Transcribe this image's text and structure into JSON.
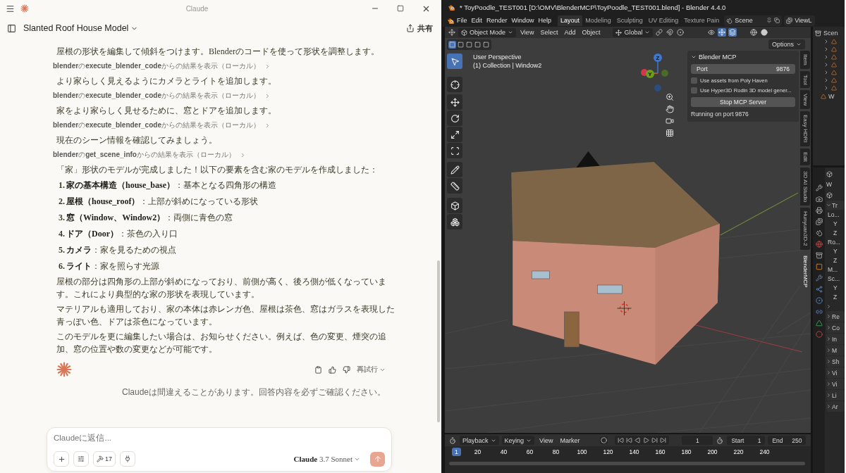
{
  "claude": {
    "window_title": "Claude",
    "conversation_title": "Slanted Roof House Model",
    "share_label": "共有",
    "messages": [
      {
        "kind": "text",
        "text": "屋根の形状を編集して傾斜をつけます。Blenderのコードを使って形状を調整します。"
      },
      {
        "kind": "tool",
        "text": "**blender**の**execute_blender_code**からの結果を表示（ローカル）"
      },
      {
        "kind": "text",
        "text": "より家らしく見えるようにカメラとライトを追加します。"
      },
      {
        "kind": "tool",
        "text": "**blender**の**execute_blender_code**からの結果を表示（ローカル）"
      },
      {
        "kind": "text",
        "text": "家をより家らしく見せるために、窓とドアを追加します。"
      },
      {
        "kind": "tool",
        "text": "**blender**の**execute_blender_code**からの結果を表示（ローカル）"
      },
      {
        "kind": "text",
        "text": "現在のシーン情報を確認してみましょう。"
      },
      {
        "kind": "tool",
        "text": "**blender**の**get_scene_info**からの結果を表示（ローカル）"
      },
      {
        "kind": "para",
        "text": "「家」形状のモデルが完成しました！以下の要素を含む家のモデルを作成しました："
      },
      {
        "kind": "item",
        "number": "1.",
        "text": "**家の基本構造（house_base）**：基本となる四角形の構造"
      },
      {
        "kind": "item",
        "number": "2.",
        "text": "**屋根（house_roof）**：上部が斜めになっている形状"
      },
      {
        "kind": "item",
        "number": "3.",
        "text": "**窓（Window、Window2）**：両側に青色の窓"
      },
      {
        "kind": "item",
        "number": "4.",
        "text": "**ドア（Door）**：茶色の入り口"
      },
      {
        "kind": "item",
        "number": "5.",
        "text": "**カメラ**：家を見るための視点"
      },
      {
        "kind": "item",
        "number": "6.",
        "text": "**ライト**：家を照らす光源"
      },
      {
        "kind": "para",
        "text": "屋根の部分は四角形の上部が斜めになっており、前側が高く、後ろ側が低くなっています。これにより典型的な家の形状を表現しています。"
      },
      {
        "kind": "para",
        "text": "マテリアルも適用しており、家の本体は赤レンガ色、屋根は茶色、窓はガラスを表現した青っぽい色、ドアは茶色になっています。"
      },
      {
        "kind": "para",
        "text": "このモデルを更に編集したい場合は、お知らせください。例えば、色の変更、煙突の追加、窓の位置や数の変更などが可能です。"
      }
    ],
    "retry_label": "再試行",
    "disclaimer": "Claudeは間違えることがあります。回答内容を必ずご確認ください。",
    "composer": {
      "placeholder": "Claudeに返信...",
      "tools_count": "17",
      "model": "**Claude** 3.7 Sonnet"
    }
  },
  "blender": {
    "window_title": "* ToyPoodle_TEST001 [D:\\OMV\\BlenderMCP\\ToyPoodle_TEST001.blend] - Blender 4.4.0",
    "menu": [
      "File",
      "Edit",
      "Render",
      "Window",
      "Help"
    ],
    "workspaces": [
      {
        "label": "Layout",
        "selected": true
      },
      {
        "label": "Modeling",
        "selected": false
      },
      {
        "label": "Sculpting",
        "selected": false
      },
      {
        "label": "UV Editing",
        "selected": false
      },
      {
        "label": "Texture Pain",
        "selected": false
      }
    ],
    "scene": "Scene",
    "view_layer": "ViewL",
    "header": {
      "mode": "Object Mode",
      "menus": [
        "View",
        "Select",
        "Add",
        "Object"
      ],
      "orientation": "Global",
      "options_label": "Options"
    },
    "viewport": {
      "view_name": "User Perspective",
      "collection": "(1) Collection | Window2",
      "gizmo_labels": [
        "Z",
        "Y"
      ],
      "tools": [
        {
          "kind": "select",
          "selected": true
        },
        {
          "kind": "cursor",
          "selected": false
        },
        {
          "kind": "move",
          "selected": false
        },
        {
          "kind": "rotate",
          "selected": false
        },
        {
          "kind": "scale",
          "selected": false
        },
        {
          "kind": "transform",
          "selected": false
        },
        {
          "kind": "annotate",
          "selected": false
        },
        {
          "kind": "measure",
          "selected": false
        },
        {
          "kind": "add_cube",
          "selected": false
        },
        {
          "kind": "add",
          "selected": false
        }
      ]
    },
    "mcp_panel": {
      "title": "Blender MCP",
      "port_label": "Port",
      "port_value": "9876",
      "options": [
        {
          "label": "Use assets from Poly Haven",
          "checked": false
        },
        {
          "label": "Use Hyper3D Rodin 3D model gener...",
          "checked": false
        }
      ],
      "button": "Stop MCP Server",
      "status": "Running on port 9876"
    },
    "sidebar_tabs": [
      {
        "label": "Item",
        "selected": false
      },
      {
        "label": "Tool",
        "selected": false
      },
      {
        "label": "View",
        "selected": false
      },
      {
        "label": "Easy HDRI",
        "selected": false
      },
      {
        "label": "Edit",
        "selected": false
      },
      {
        "label": "3D AI Studio",
        "selected": false
      },
      {
        "label": "Hunyuan3D-2",
        "selected": false
      },
      {
        "label": "BlenderMCP",
        "selected": true
      }
    ],
    "outliner": {
      "scene_label": "Scen",
      "last_row": "W"
    },
    "properties": {
      "object_name": "W",
      "transform_title": "Tr",
      "transform_rows": [
        "Lo...",
        "Y",
        "Z",
        "Ro...",
        "Y",
        "Z",
        "M...",
        "Sc...",
        "Y",
        "Z"
      ],
      "panels": [
        "Re",
        "Co",
        "In",
        "M",
        "Sh",
        "Vi",
        "Vi",
        "Li",
        "Ar"
      ]
    },
    "timeline": {
      "menus": [
        "Playback",
        "Keying",
        "View",
        "Marker"
      ],
      "current_frame": "1",
      "start_label": "Start",
      "start": "1",
      "end_label": "End",
      "end": "250",
      "ruler": [
        {
          "label": "1",
          "selected": true
        },
        {
          "label": "20",
          "selected": false
        },
        {
          "label": "40",
          "selected": false
        },
        {
          "label": "60",
          "selected": false
        },
        {
          "label": "80",
          "selected": false
        },
        {
          "label": "100",
          "selected": false
        },
        {
          "label": "120",
          "selected": false
        },
        {
          "label": "140",
          "selected": false
        },
        {
          "label": "160",
          "selected": false
        },
        {
          "label": "180",
          "selected": false
        },
        {
          "label": "200",
          "selected": false
        },
        {
          "label": "220",
          "selected": false
        },
        {
          "label": "240",
          "selected": false
        }
      ]
    }
  }
}
